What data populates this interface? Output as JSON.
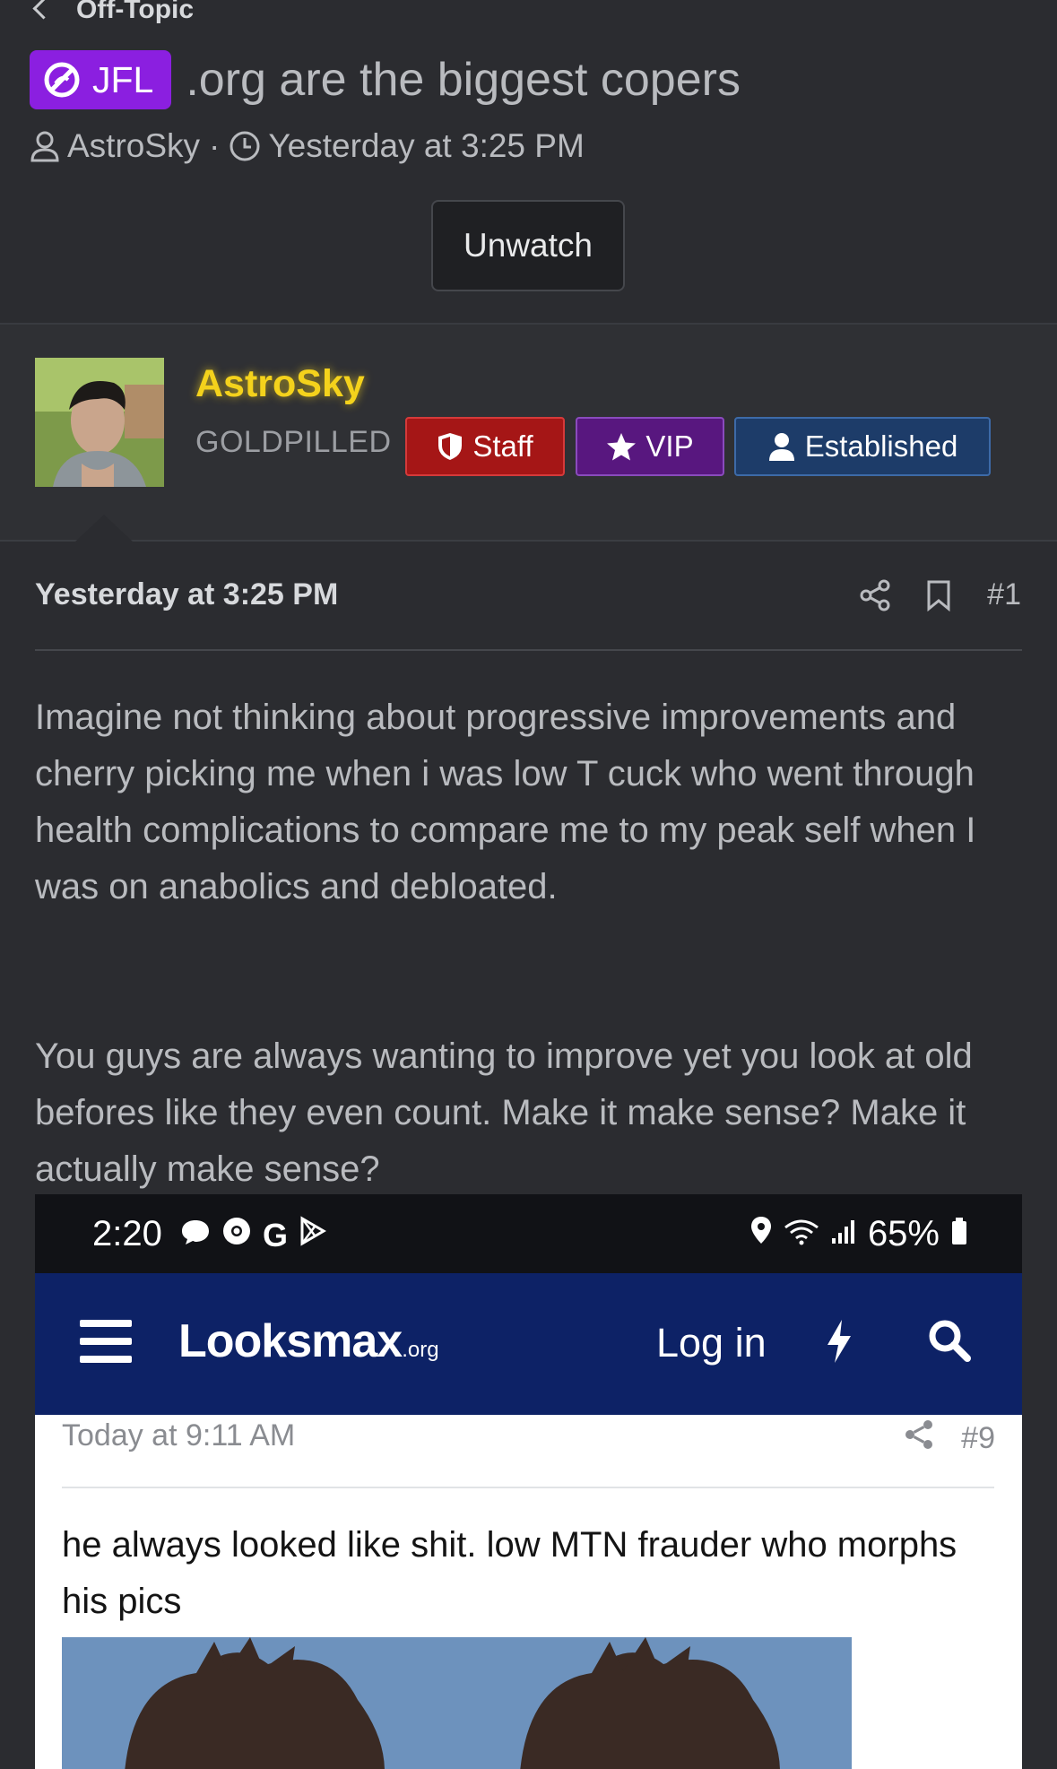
{
  "breadcrumb": {
    "label": "Off-Topic"
  },
  "thread": {
    "prefix": "JFL",
    "title": ".org are the biggest copers",
    "author": "AstroSky",
    "separator": "·",
    "time": "Yesterday at 3:25 PM",
    "unwatch_label": "Unwatch"
  },
  "user": {
    "name": "AstroSky",
    "title": "GOLDPILLED",
    "badges": {
      "staff": "Staff",
      "vip": "VIP",
      "established": "Established"
    }
  },
  "post": {
    "date": "Yesterday at 3:25 PM",
    "number": "#1",
    "paragraphs": [
      "Imagine not thinking about progressive improvements and cherry picking me when i was low T cuck who went through health complications to compare me to my peak self when I was on anabolics and debloated.",
      "You guys are always wanting to improve yet you look at old befores like they even count. Make it make sense? Make it actually make sense?"
    ]
  },
  "embedded_screenshot": {
    "status_bar": {
      "time": "2:20",
      "app_glyph": "G",
      "battery": "65%"
    },
    "site": {
      "logo": "Looksmax",
      "logo_suffix": ".org",
      "login_label": "Log in"
    },
    "post": {
      "date": "Today at 9:11 AM",
      "number": "#9",
      "text": "he always looked like shit. low MTN frauder who morphs his pics"
    }
  },
  "colors": {
    "background": "#2b2c30",
    "prefix": "#8b1fe0",
    "username": "#f4d21c",
    "staff": "#a51616",
    "vip": "#58177f",
    "established": "#1d3c69",
    "site_header": "#0d2266"
  }
}
